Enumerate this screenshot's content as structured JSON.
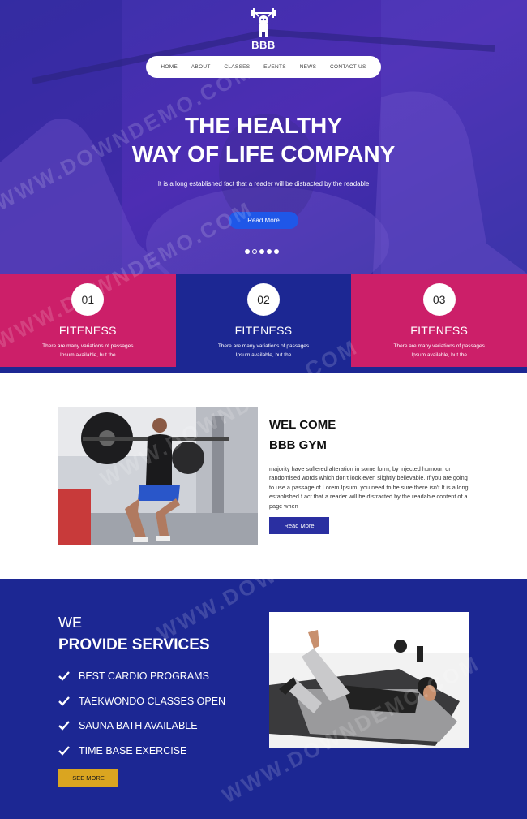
{
  "brand": {
    "name": "BBB"
  },
  "nav": {
    "items": [
      "HOME",
      "ABOUT",
      "CLASSES",
      "EVENTS",
      "NEWS",
      "CONTACT US"
    ]
  },
  "hero": {
    "title_line1": "THE HEALTHY",
    "title_line2": "WAY OF LIFE COMPANY",
    "subtitle": "It is a long established fact that a reader will be distracted by the readable",
    "button": "Read More",
    "slides": 5,
    "active_slide": 2
  },
  "features": [
    {
      "num": "01",
      "title": "FITENESS",
      "line1": "There are many variations of passages",
      "line2": "Ipsum available, but the"
    },
    {
      "num": "02",
      "title": "FITENESS",
      "line1": "There are many variations of passages",
      "line2": "Ipsum available, but the"
    },
    {
      "num": "03",
      "title": "FITENESS",
      "line1": "There are many variations of passages",
      "line2": "Ipsum available, but the"
    }
  ],
  "welcome": {
    "heading1": "WEL COME",
    "heading2": "BBB GYM",
    "body": "majority have suffered alteration in some form, by injected humour, or randomised words which don't look even slightly believable. If you are going to use a passage of Lorem Ipsum, you need to be sure there isn't It is a long established f act that a reader will be distracted by the readable content of a page when",
    "button": "Read More"
  },
  "services": {
    "heading1": "WE",
    "heading2": "PROVIDE SERVICES",
    "items": [
      "BEST CARDIO PROGRAMS",
      "TAEKWONDO CLASSES OPEN",
      "SAUNA BATH AVAILABLE",
      "TIME BASE EXERCISE"
    ],
    "button": "SEE MORE"
  },
  "watermark": "WWW.DOWNDEMO.COM",
  "colors": {
    "hero_blue": "#3b2fa6",
    "pink": "#cc1f69",
    "navy": "#1c2793",
    "gold": "#daa520",
    "button_blue": "#1f57e8"
  }
}
